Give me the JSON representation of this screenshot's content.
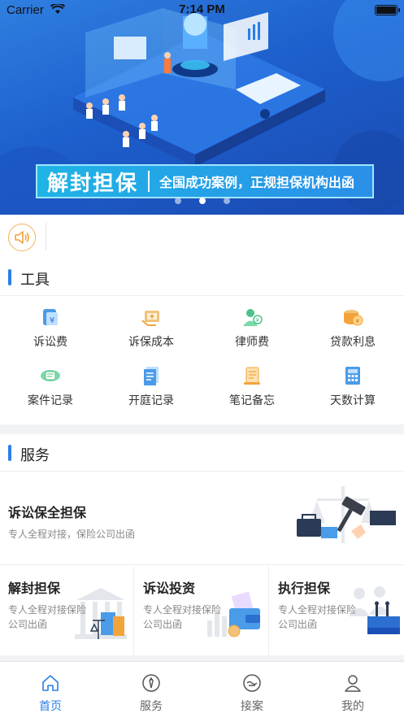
{
  "status_bar": {
    "carrier": "Carrier",
    "time": "7:14 PM"
  },
  "banner": {
    "caption_main": "解封担保",
    "caption_sub": "全国成功案例，正规担保机构出函",
    "page_count": 3,
    "active_page": 2
  },
  "tools": {
    "title": "工具",
    "items": [
      {
        "label": "诉讼费",
        "icon": "fee-icon"
      },
      {
        "label": "诉保成本",
        "icon": "cost-icon"
      },
      {
        "label": "律师费",
        "icon": "lawyer-icon"
      },
      {
        "label": "贷款利息",
        "icon": "coins-icon"
      },
      {
        "label": "案件记录",
        "icon": "case-icon"
      },
      {
        "label": "开庭记录",
        "icon": "document-icon"
      },
      {
        "label": "笔记备忘",
        "icon": "scroll-icon"
      },
      {
        "label": "天数计算",
        "icon": "calculator-icon"
      }
    ]
  },
  "services": {
    "title": "服务",
    "main": {
      "title": "诉讼保全担保",
      "subtitle": "专人全程对接，保险公司出函"
    },
    "cells": [
      {
        "title": "解封担保",
        "subtitle": "专人全程对接保险公司出函"
      },
      {
        "title": "诉讼投资",
        "subtitle": "专人全程对接保险公司出函"
      },
      {
        "title": "执行担保",
        "subtitle": "专人全程对接保险公司出函"
      }
    ]
  },
  "tabbar": {
    "items": [
      {
        "label": "首页",
        "icon": "home-icon",
        "active": true
      },
      {
        "label": "服务",
        "icon": "service-icon",
        "active": false
      },
      {
        "label": "接案",
        "icon": "handshake-icon",
        "active": false
      },
      {
        "label": "我的",
        "icon": "profile-icon",
        "active": false
      }
    ]
  },
  "colors": {
    "accent": "#2b7fe6",
    "banner": "#1d5fcc",
    "icon_orange": "#f2a43a",
    "icon_blue": "#4a9be8",
    "icon_green": "#4cc38a"
  }
}
